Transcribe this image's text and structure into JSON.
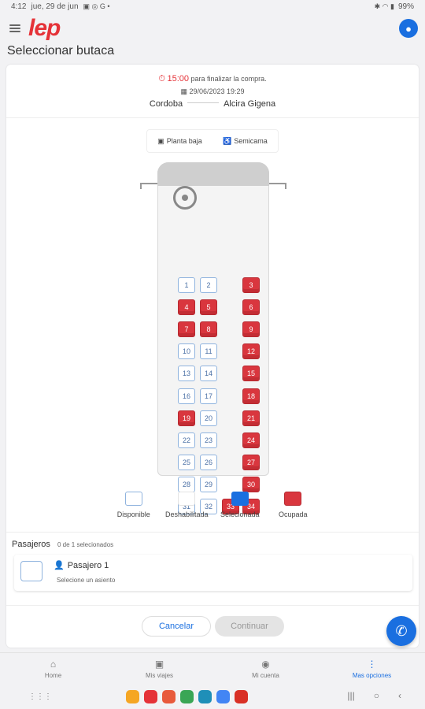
{
  "status_bar": {
    "time": "4:12",
    "date": "jue, 29 de jun",
    "battery": "99%"
  },
  "header": {
    "logo": "lep",
    "title": "Seleccionar butaca"
  },
  "trip": {
    "timer": "15:00",
    "timer_suffix": "para finalizar la compra.",
    "datetime": "29/06/2023 19:29",
    "origin": "Cordoba",
    "destination": "Alcira Gigena"
  },
  "floors": {
    "lower": "Planta baja",
    "type": "Semicama"
  },
  "seats": [
    {
      "n": "1",
      "state": "free"
    },
    {
      "n": "2",
      "state": "free"
    },
    {
      "n": "3",
      "state": "taken"
    },
    {
      "n": "4",
      "state": "taken"
    },
    {
      "n": "5",
      "state": "taken"
    },
    {
      "n": "6",
      "state": "taken"
    },
    {
      "n": "7",
      "state": "taken"
    },
    {
      "n": "8",
      "state": "taken"
    },
    {
      "n": "9",
      "state": "taken"
    },
    {
      "n": "10",
      "state": "free"
    },
    {
      "n": "11",
      "state": "free"
    },
    {
      "n": "12",
      "state": "taken"
    },
    {
      "n": "13",
      "state": "free"
    },
    {
      "n": "14",
      "state": "free"
    },
    {
      "n": "15",
      "state": "taken"
    },
    {
      "n": "16",
      "state": "free"
    },
    {
      "n": "17",
      "state": "free"
    },
    {
      "n": "18",
      "state": "taken"
    },
    {
      "n": "19",
      "state": "taken"
    },
    {
      "n": "20",
      "state": "free"
    },
    {
      "n": "21",
      "state": "taken"
    },
    {
      "n": "22",
      "state": "free"
    },
    {
      "n": "23",
      "state": "free"
    },
    {
      "n": "24",
      "state": "taken"
    },
    {
      "n": "25",
      "state": "free"
    },
    {
      "n": "26",
      "state": "free"
    },
    {
      "n": "27",
      "state": "taken"
    },
    {
      "n": "28",
      "state": "free"
    },
    {
      "n": "29",
      "state": "free"
    },
    {
      "n": "30",
      "state": "taken"
    },
    {
      "n": "31",
      "state": "free"
    },
    {
      "n": "32",
      "state": "free"
    },
    {
      "n": "33",
      "state": "taken"
    },
    {
      "n": "34",
      "state": "taken"
    }
  ],
  "legend": [
    {
      "label": "Disponible",
      "color": "#ffffff",
      "border": "#8fb3de"
    },
    {
      "label": "Deshabilitada",
      "color": "#ffffff",
      "border": "#e4e4e4"
    },
    {
      "label": "Selecionada",
      "color": "#1a6fe0",
      "border": "#1a6fe0"
    },
    {
      "label": "Ocupada",
      "color": "#d9363e",
      "border": "#b82a31"
    }
  ],
  "passengers": {
    "title": "Pasajeros",
    "count": "0 de 1 selecionados",
    "items": [
      {
        "name": "Pasajero 1",
        "note": "Selecione un asiento"
      }
    ]
  },
  "actions": {
    "cancel": "Cancelar",
    "continue": "Continuar"
  },
  "bottom_nav": [
    {
      "label": "Home",
      "icon": "home-icon",
      "glyph": "⌂",
      "active": false
    },
    {
      "label": "Mis viajes",
      "icon": "bus-icon",
      "glyph": "▣",
      "active": false
    },
    {
      "label": "Mi cuenta",
      "icon": "user-icon",
      "glyph": "◉",
      "active": false
    },
    {
      "label": "Mas opciones",
      "icon": "more-icon",
      "glyph": "⋮",
      "active": true
    }
  ],
  "dock_apps": [
    {
      "name": "folder-app-icon",
      "color": "#f5a623"
    },
    {
      "name": "notes-app-icon",
      "color": "#e53238"
    },
    {
      "name": "contacts-app-icon",
      "color": "#e85a3c"
    },
    {
      "name": "apps-app-icon",
      "color": "#3aa655"
    },
    {
      "name": "calendar-app-icon",
      "color": "#1f8fb8"
    },
    {
      "name": "chrome-app-icon",
      "color": "#4285f4"
    },
    {
      "name": "gmail-app-icon",
      "color": "#d93025"
    }
  ]
}
